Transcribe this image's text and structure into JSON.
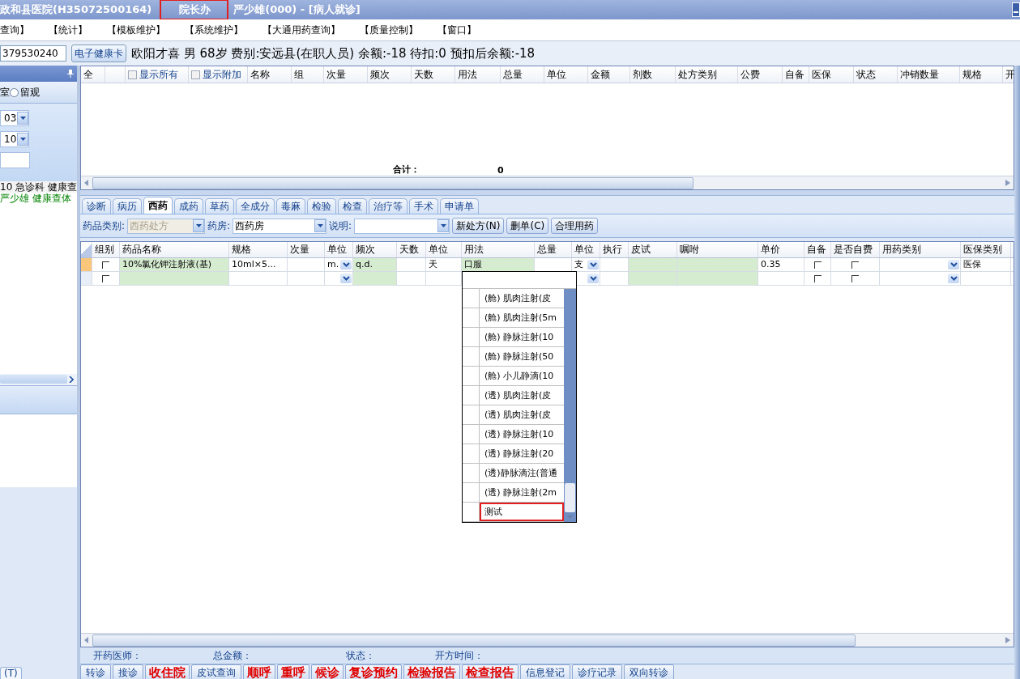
{
  "title_bar": {
    "hospital": "政和县医院(H35072500164)",
    "department": {
      "label": "院长办",
      "highlighted": true
    },
    "user": "严少雄(000) - [病人就诊]"
  },
  "menu": [
    "查询】",
    "【统计】",
    "【模板维护】",
    "【系统维护】",
    "【大通用药查询】",
    "【质量控制】",
    "【窗口】"
  ],
  "patient_bar": {
    "card_number": "379530240",
    "card_button": "电子健康卡",
    "info": "欧阳才喜 男 68岁 费别:安远县(在职人员) 余额:-18 待扣:0 预扣后余额:-18"
  },
  "left_panel": {
    "radio_prefix": "室",
    "radios": [
      {
        "label": "留观",
        "selected": false
      }
    ],
    "selects": [
      "03",
      "10"
    ],
    "list": [
      {
        "text": "10 急诊科 健康查",
        "kind": "visit"
      },
      {
        "text": "严少雄 健康查体",
        "kind": "patient"
      }
    ],
    "bottom_tab": "(T)"
  },
  "order_grid": {
    "columns": [
      {
        "kind": "text",
        "label": "全"
      },
      {
        "kind": "spacer"
      },
      {
        "kind": "checkbox",
        "label": "显示所有",
        "checked": false
      },
      {
        "kind": "checkbox",
        "label": "显示附加",
        "checked": false
      },
      {
        "kind": "text",
        "label": "名称"
      },
      {
        "kind": "text",
        "label": "组"
      },
      {
        "kind": "text",
        "label": "次量"
      },
      {
        "kind": "text",
        "label": "频次"
      },
      {
        "kind": "text",
        "label": "天数"
      },
      {
        "kind": "text",
        "label": "用法"
      },
      {
        "kind": "text",
        "label": "总量"
      },
      {
        "kind": "text",
        "label": "单位"
      },
      {
        "kind": "text",
        "label": "金额"
      },
      {
        "kind": "text",
        "label": "剂数"
      },
      {
        "kind": "text",
        "label": "处方类别"
      },
      {
        "kind": "text",
        "label": "公费"
      },
      {
        "kind": "text",
        "label": "自备"
      },
      {
        "kind": "text",
        "label": "医保"
      },
      {
        "kind": "text",
        "label": "状态"
      },
      {
        "kind": "text",
        "label": "冲销数量"
      },
      {
        "kind": "text",
        "label": "规格"
      },
      {
        "kind": "text",
        "label": "开"
      }
    ],
    "total_label": "合计：",
    "total_value": "0"
  },
  "tabs": [
    {
      "label": "诊断",
      "selected": false
    },
    {
      "label": "病历",
      "selected": false
    },
    {
      "label": "西药",
      "selected": true
    },
    {
      "label": "成药",
      "selected": false
    },
    {
      "label": "草药",
      "selected": false
    },
    {
      "label": "全成分",
      "selected": false
    },
    {
      "label": "毒麻",
      "selected": false
    },
    {
      "label": "检验",
      "selected": false
    },
    {
      "label": "检查",
      "selected": false
    },
    {
      "label": "治疗等",
      "selected": false
    },
    {
      "label": "手术",
      "selected": false
    },
    {
      "label": "申请单",
      "selected": false
    }
  ],
  "toolbar": {
    "category_label": "药品类别:",
    "category_value": "西药处方",
    "category_disabled": true,
    "pharmacy_label": "药房:",
    "pharmacy_value": "西药房",
    "note_label": "说明:",
    "buttons": [
      "新处方(N)",
      "删单(C)",
      "合理用药"
    ]
  },
  "drug_grid": {
    "columns": [
      {
        "label": "组别",
        "shaded": false
      },
      {
        "label": "药品名称",
        "shaded": true
      },
      {
        "label": "规格",
        "shaded": false
      },
      {
        "label": "次量",
        "shaded": false
      },
      {
        "label": "单位",
        "shaded": false
      },
      {
        "label": "频次",
        "shaded": true
      },
      {
        "label": "天数",
        "shaded": false
      },
      {
        "label": "单位",
        "shaded": false
      },
      {
        "label": "用法",
        "shaded": true
      },
      {
        "label": "总量",
        "shaded": false
      },
      {
        "label": "单位",
        "shaded": false
      },
      {
        "label": "执行",
        "shaded": false
      },
      {
        "label": "皮试",
        "shaded": true
      },
      {
        "label": "嘱咐",
        "shaded": true
      },
      {
        "label": "单价",
        "shaded": false
      },
      {
        "label": "自备",
        "shaded": false
      },
      {
        "label": "是否自费",
        "shaded": false
      },
      {
        "label": "用药类别",
        "shaded": false
      },
      {
        "label": "医保类别",
        "shaded": false
      }
    ],
    "rows": [
      {
        "current": true,
        "cells": [
          {
            "kind": "check",
            "checked": false
          },
          {
            "kind": "text",
            "value": "10%氯化钾注射液(基)"
          },
          {
            "kind": "text",
            "value": "10ml×5..."
          },
          {
            "kind": "text"
          },
          {
            "kind": "select",
            "value": "m."
          },
          {
            "kind": "text",
            "value": "q.d."
          },
          {
            "kind": "text"
          },
          {
            "kind": "text",
            "value": "天"
          },
          {
            "kind": "text",
            "value": "口服"
          },
          {
            "kind": "text"
          },
          {
            "kind": "select",
            "value": "支"
          },
          {
            "kind": "text"
          },
          {
            "kind": "text"
          },
          {
            "kind": "text"
          },
          {
            "kind": "text",
            "value": "0.35"
          },
          {
            "kind": "check",
            "checked": false
          },
          {
            "kind": "check",
            "checked": false
          },
          {
            "kind": "select"
          },
          {
            "kind": "text",
            "value": "医保"
          }
        ]
      },
      {
        "current": false,
        "cells": [
          {
            "kind": "check",
            "checked": false
          },
          {
            "kind": "text"
          },
          {
            "kind": "text"
          },
          {
            "kind": "text"
          },
          {
            "kind": "select"
          },
          {
            "kind": "text"
          },
          {
            "kind": "text"
          },
          {
            "kind": "text"
          },
          {
            "kind": "editing"
          },
          {
            "kind": "text"
          },
          {
            "kind": "select"
          },
          {
            "kind": "text"
          },
          {
            "kind": "text"
          },
          {
            "kind": "text"
          },
          {
            "kind": "text"
          },
          {
            "kind": "check",
            "checked": false
          },
          {
            "kind": "check",
            "checked": false
          },
          {
            "kind": "select"
          },
          {
            "kind": "text"
          }
        ]
      }
    ],
    "dropdown": [
      {
        "label": "(舱) 肌肉注射(皮",
        "highlighted": false
      },
      {
        "label": "(舱) 肌肉注射(5m",
        "highlighted": false
      },
      {
        "label": "(舱) 静脉注射(10",
        "highlighted": false
      },
      {
        "label": "(舱) 静脉注射(50",
        "highlighted": false
      },
      {
        "label": "(舱) 小儿静滴(10",
        "highlighted": false
      },
      {
        "label": "(透) 肌肉注射(皮",
        "highlighted": false
      },
      {
        "label": "(透) 肌肉注射(皮",
        "highlighted": false
      },
      {
        "label": "(透) 静脉注射(10",
        "highlighted": false
      },
      {
        "label": "(透) 静脉注射(20",
        "highlighted": false
      },
      {
        "label": "(透)静脉滴注(普通",
        "highlighted": false
      },
      {
        "label": "(透) 静脉注射(2m",
        "highlighted": false
      },
      {
        "label": "测试",
        "highlighted": true
      }
    ]
  },
  "status_row": [
    "开药医师：",
    "总金额：",
    "状态：",
    "开方时间："
  ],
  "action_buttons": [
    {
      "label": "转诊",
      "emphasis": false
    },
    {
      "label": "接诊",
      "emphasis": false
    },
    {
      "label": "收住院",
      "emphasis": true
    },
    {
      "label": "皮试查询",
      "emphasis": false
    },
    {
      "label": "顺呼",
      "emphasis": true
    },
    {
      "label": "重呼",
      "emphasis": true
    },
    {
      "label": "候诊",
      "emphasis": true
    },
    {
      "label": "复诊预约",
      "emphasis": true
    },
    {
      "label": "检验报告",
      "emphasis": true
    },
    {
      "label": "检查报告",
      "emphasis": true
    },
    {
      "label": "信息登记",
      "emphasis": false
    },
    {
      "label": "诊疗记录",
      "emphasis": false
    },
    {
      "label": "双向转诊",
      "emphasis": false
    }
  ]
}
